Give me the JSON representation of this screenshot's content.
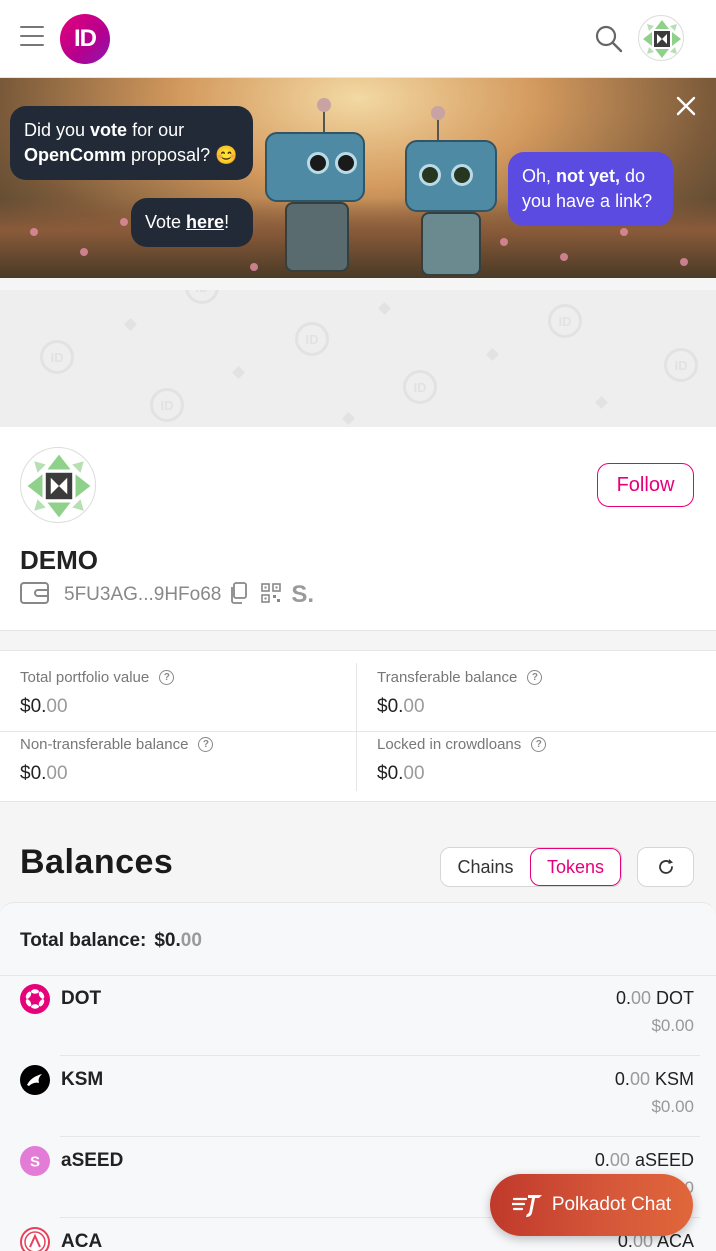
{
  "header": {
    "logo_text": "ID"
  },
  "banner": {
    "bubble_left": {
      "pre": "Did you ",
      "bold": "vote",
      "mid": " for our",
      "bold2": "OpenComm",
      "post": " proposal? 😊"
    },
    "bubble_vote": {
      "pre": "Vote ",
      "link": "here",
      "post": "!"
    },
    "bubble_right": {
      "pre": "Oh, ",
      "bold": "not yet,",
      "mid": " do",
      "line2": "you have a link?"
    }
  },
  "profile": {
    "name": "DEMO",
    "address": "5FU3AG...9HFo68",
    "follow_label": "Follow",
    "subscan_mark": "S."
  },
  "stats": {
    "total_portfolio": {
      "label": "Total portfolio value",
      "value_main": "$0.",
      "value_dim": "00"
    },
    "transferable": {
      "label": "Transferable balance",
      "value_main": "$0.",
      "value_dim": "00"
    },
    "non_transferable": {
      "label": "Non-transferable balance",
      "value_main": "$0.",
      "value_dim": "00"
    },
    "crowdloans": {
      "label": "Locked in crowdloans",
      "value_main": "$0.",
      "value_dim": "00"
    }
  },
  "balances": {
    "title": "Balances",
    "tab_chains": "Chains",
    "tab_tokens": "Tokens",
    "total_label": "Total balance:",
    "total_main": "$0.",
    "total_dim": "00",
    "tokens": [
      {
        "name": "DOT",
        "amt_main": "0.",
        "amt_dim": "00",
        "symbol": "DOT",
        "usd": "$0.00",
        "color": "#e6007a"
      },
      {
        "name": "KSM",
        "amt_main": "0.",
        "amt_dim": "00",
        "symbol": "KSM",
        "usd": "$0.00",
        "color": "#000000"
      },
      {
        "name": "aSEED",
        "amt_main": "0.",
        "amt_dim": "00",
        "symbol": "aSEED",
        "usd": "$0.00",
        "color": "#e27cd7"
      },
      {
        "name": "ACA",
        "amt_main": "0.",
        "amt_dim": "00",
        "symbol": "ACA",
        "usd": "",
        "color": "#e8405b"
      }
    ]
  },
  "chat": {
    "label": "Polkadot Chat"
  }
}
